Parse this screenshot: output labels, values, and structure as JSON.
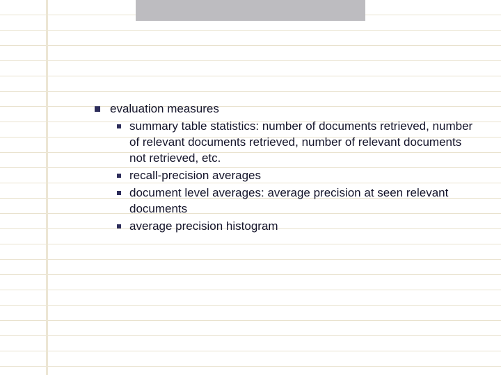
{
  "slide": {
    "bullets": [
      {
        "label": "evaluation measures",
        "children": [
          {
            "label": "summary table statistics: number of documents retrieved, number of relevant documents retrieved, number of relevant documents not retrieved, etc."
          },
          {
            "label": "recall-precision averages"
          },
          {
            "label": "document level averages: average precision at seen relevant documents"
          },
          {
            "label": "average precision histogram"
          }
        ]
      }
    ]
  }
}
